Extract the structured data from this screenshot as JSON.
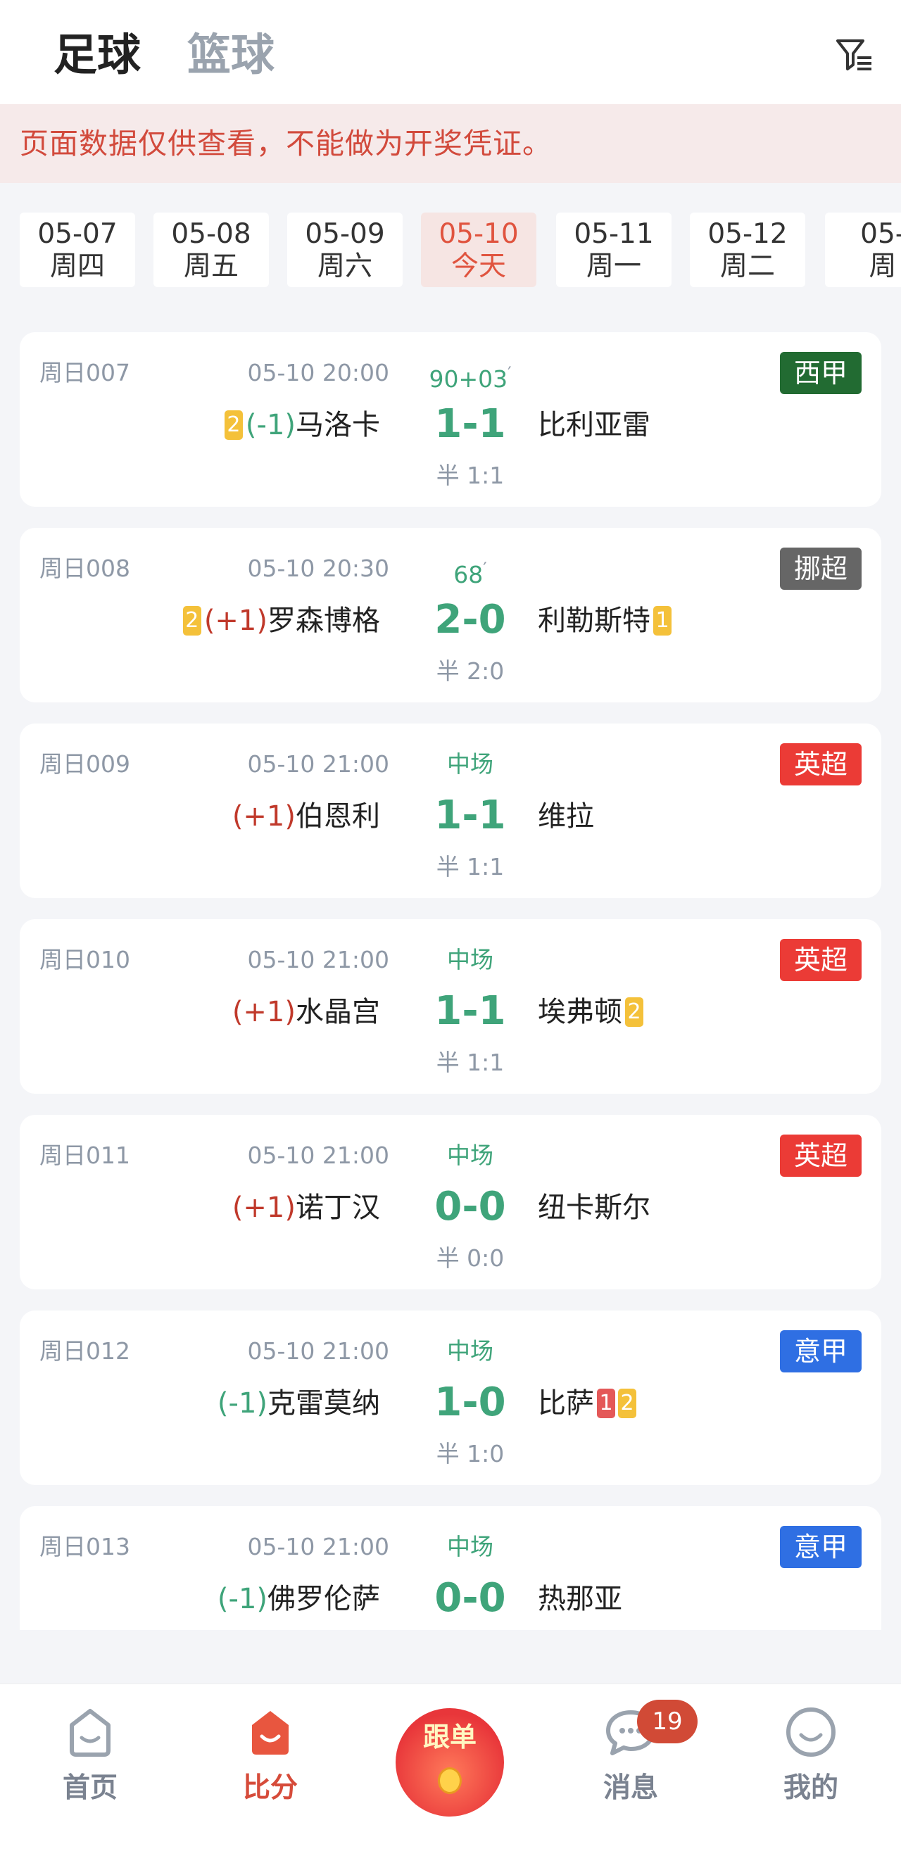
{
  "header": {
    "tabs": [
      {
        "label": "足球",
        "active": true
      },
      {
        "label": "篮球",
        "active": false
      }
    ],
    "filter_icon": "filter-icon"
  },
  "notice": {
    "text": "页面数据仅供查看，不能做为开奖凭证。"
  },
  "dates": [
    {
      "date": "05-07",
      "weekday": "周四"
    },
    {
      "date": "05-08",
      "weekday": "周五"
    },
    {
      "date": "05-09",
      "weekday": "周六"
    },
    {
      "date": "05-10",
      "weekday": "今天",
      "active": true
    },
    {
      "date": "05-11",
      "weekday": "周一"
    },
    {
      "date": "05-12",
      "weekday": "周二"
    },
    {
      "date": "05-",
      "weekday": "周"
    }
  ],
  "matches": [
    {
      "no": "周日007",
      "time": "05-10 20:00",
      "status": "90+03",
      "status_mark": "′",
      "league": "西甲",
      "league_color": "#226b32",
      "home_cards": "2",
      "home_handicap": "(-1)",
      "home": "马洛卡",
      "score": "1-1",
      "away": "比利亚雷",
      "half": "半 1:1"
    },
    {
      "no": "周日008",
      "time": "05-10 20:30",
      "status": "68",
      "status_mark": "′",
      "league": "挪超",
      "league_color": "#666666",
      "home_cards": "2",
      "home_handicap": "(+1)",
      "home": "罗森博格",
      "score": "2-0",
      "away": "利勒斯特",
      "away_yellow": "1",
      "half": "半 2:0"
    },
    {
      "no": "周日009",
      "time": "05-10 21:00",
      "status": "中场",
      "league": "英超",
      "league_color": "#eb3b36",
      "home_handicap": "(+1)",
      "home": "伯恩利",
      "score": "1-1",
      "away": "维拉",
      "half": "半 1:1"
    },
    {
      "no": "周日010",
      "time": "05-10 21:00",
      "status": "中场",
      "league": "英超",
      "league_color": "#eb3b36",
      "home_handicap": "(+1)",
      "home": "水晶宫",
      "score": "1-1",
      "away": "埃弗顿",
      "away_yellow": "2",
      "half": "半 1:1"
    },
    {
      "no": "周日011",
      "time": "05-10 21:00",
      "status": "中场",
      "league": "英超",
      "league_color": "#eb3b36",
      "home_handicap": "(+1)",
      "home": "诺丁汉",
      "score": "0-0",
      "away": "纽卡斯尔",
      "half": "半 0:0"
    },
    {
      "no": "周日012",
      "time": "05-10 21:00",
      "status": "中场",
      "league": "意甲",
      "league_color": "#2f6fe3",
      "home_handicap": "(-1)",
      "home": "克雷莫纳",
      "score": "1-0",
      "away": "比萨",
      "away_red": "1",
      "away_yellow": "2",
      "half": "半 1:0"
    },
    {
      "no": "周日013",
      "time": "05-10 21:00",
      "status": "中场",
      "league": "意甲",
      "league_color": "#2f6fe3",
      "home_handicap": "(-1)",
      "home": "佛罗伦萨",
      "score": "0-0",
      "away": "热那亚"
    }
  ],
  "tabbar": {
    "items": [
      {
        "label": "首页",
        "icon": "home-icon"
      },
      {
        "label": "比分",
        "icon": "score-icon",
        "active": true
      },
      {
        "label": "跟单",
        "icon": "follow-icon"
      },
      {
        "label": "消息",
        "icon": "message-icon",
        "badge": "19"
      },
      {
        "label": "我的",
        "icon": "profile-icon"
      }
    ]
  },
  "colors": {
    "accent": "#d64b3a",
    "live_green": "#3fa47a",
    "muted": "#8e98a6",
    "yellow_card": "#f4c13a",
    "red_card": "#e45858"
  }
}
